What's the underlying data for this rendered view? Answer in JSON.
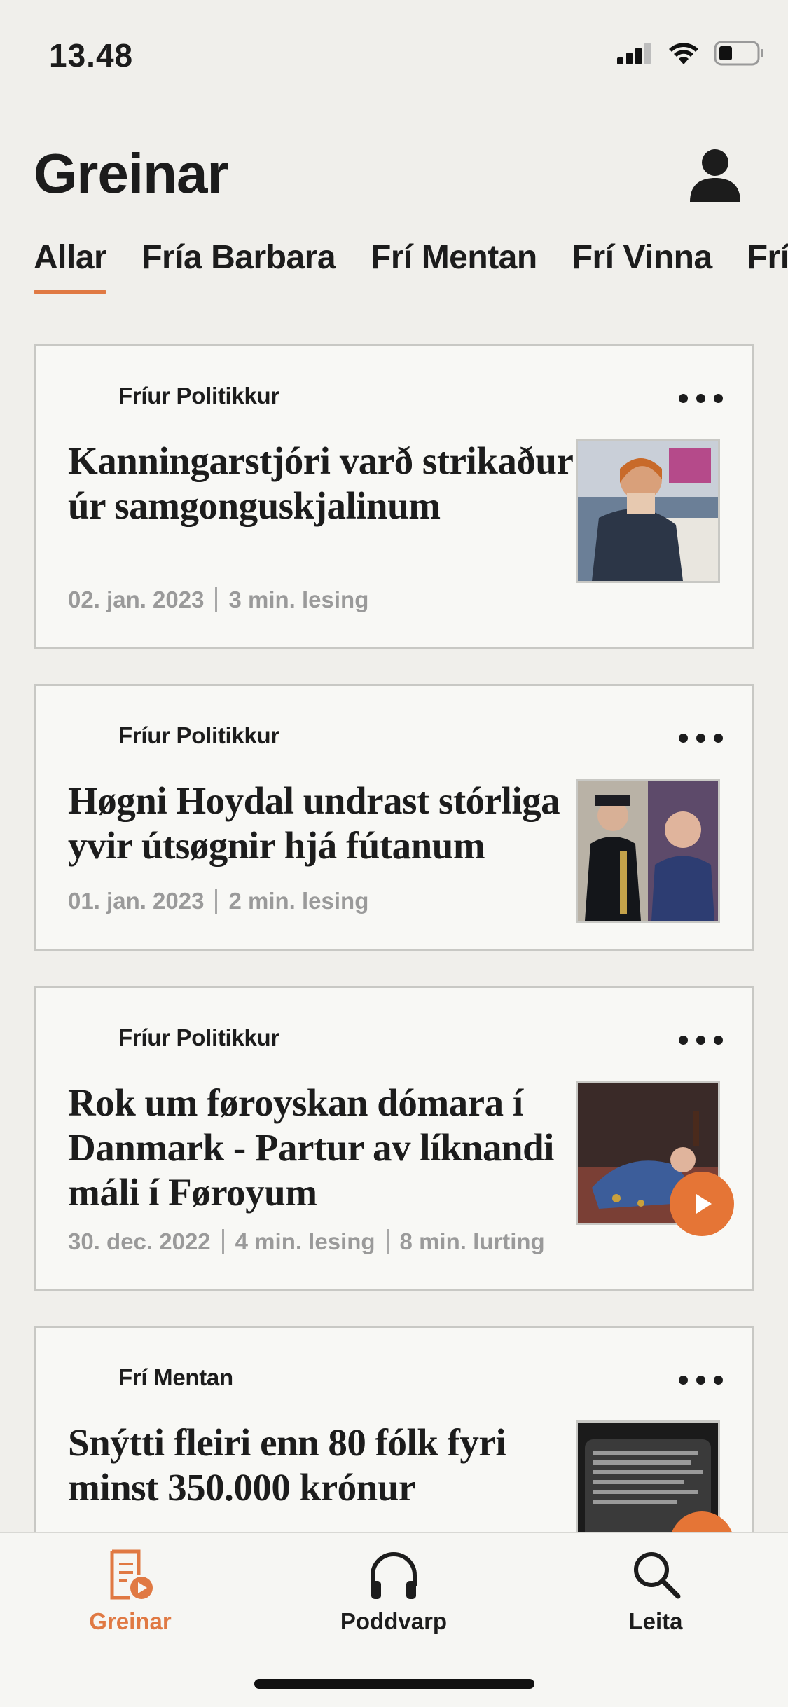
{
  "status_bar": {
    "time": "13.48"
  },
  "header": {
    "title": "Greinar"
  },
  "tabs": [
    {
      "label": "Allar",
      "active": true
    },
    {
      "label": "Fría Barbara",
      "active": false
    },
    {
      "label": "Frí Mentan",
      "active": false
    },
    {
      "label": "Frí Vinna",
      "active": false
    },
    {
      "label": "Frí",
      "active": false
    }
  ],
  "articles": [
    {
      "category": "Fríur Politikkur",
      "title": "Kanningarstjóri varð strikaður úr samgonguskjalinum",
      "date": "02. jan. 2023",
      "read_time": "3 min. lesing",
      "listen_time": "",
      "has_audio": false
    },
    {
      "category": "Fríur Politikkur",
      "title": "Høgni Hoydal undrast stórliga yvir útsøgnir hjá fútanum",
      "date": "01. jan. 2023",
      "read_time": "2 min. lesing",
      "listen_time": "",
      "has_audio": false
    },
    {
      "category": "Fríur Politikkur",
      "title": "Rok um føroyskan dómara í Danmark - Partur av líknandi máli í Føroyum",
      "date": "30. dec. 2022",
      "read_time": "4 min. lesing",
      "listen_time": "8 min. lurting",
      "has_audio": true
    },
    {
      "category": "Frí Mentan",
      "title": "Snýtti fleiri enn 80 fólk fyri minst 350.000 krónur",
      "date": "",
      "read_time": "",
      "listen_time": "",
      "has_audio": true
    }
  ],
  "bottom_nav": [
    {
      "label": "Greinar",
      "icon": "articles-icon",
      "active": true
    },
    {
      "label": "Poddvarp",
      "icon": "headphones-icon",
      "active": false
    },
    {
      "label": "Leita",
      "icon": "search-icon",
      "active": false
    }
  ],
  "colors": {
    "accent": "#e07943",
    "background": "#f0efeb",
    "card": "#f8f8f5",
    "meta_text": "#9a9a9a"
  }
}
